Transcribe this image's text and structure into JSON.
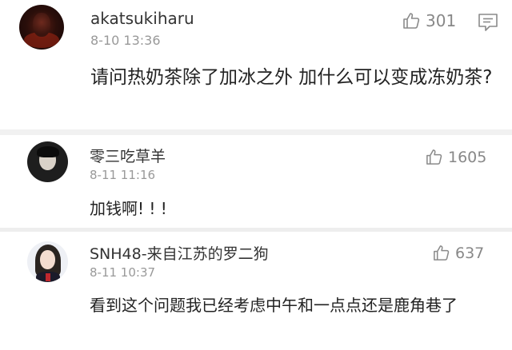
{
  "comments": [
    {
      "username": "akatsukiharu",
      "timestamp": "8-10 13:36",
      "likes": "301",
      "text": "请问热奶茶除了加冰之外 加什么可以变成冻奶茶?",
      "avatar_icon": "dark-red-portrait-avatar"
    },
    {
      "username": "零三吃草羊",
      "timestamp": "8-11 11:16",
      "likes": "1605",
      "text": "加钱啊! ! !",
      "avatar_icon": "dark-portrait-avatar"
    },
    {
      "username": "SNH48-来自江苏的罗二狗",
      "timestamp": "8-11 10:37",
      "likes": "637",
      "text": "看到这个问题我已经考虑中午和一点点还是鹿角巷了",
      "avatar_icon": "girl-school-uniform-avatar"
    }
  ],
  "icons": {
    "like": "thumbs-up-icon",
    "reply": "comment-bubble-icon"
  },
  "colors": {
    "username": "#333333",
    "timestamp": "#999999",
    "body_text": "#222222",
    "divider": "#f1f1f1"
  }
}
